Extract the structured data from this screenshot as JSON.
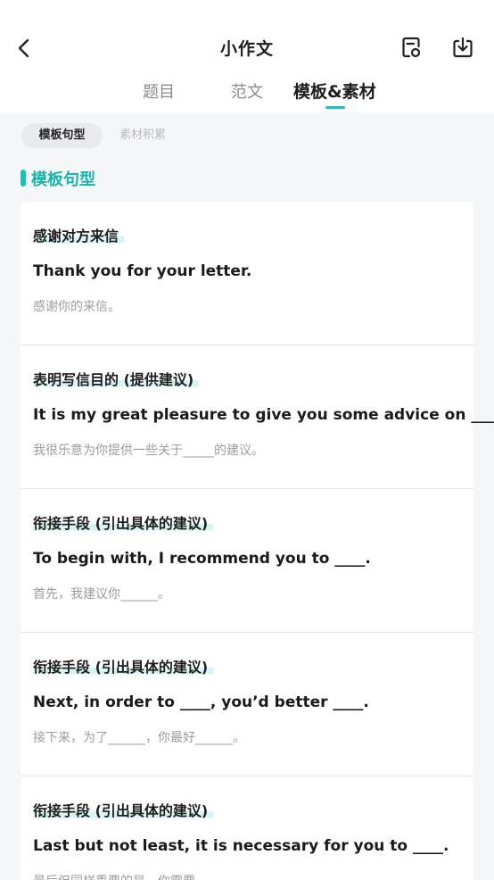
{
  "header": {
    "title": "小作文",
    "icons": [
      "back-arrow-icon",
      "document-settings-icon",
      "download-icon"
    ]
  },
  "tabs": [
    {
      "label": "题目",
      "active": false
    },
    {
      "label": "范文",
      "active": false
    },
    {
      "label": "模板&素材",
      "active": true
    }
  ],
  "chips": [
    {
      "label": "模板句型",
      "active": true
    },
    {
      "label": "素材积累",
      "active": false
    }
  ],
  "section": {
    "title": "模板句型"
  },
  "cards": [
    {
      "label": "感谢对方来信",
      "en": "Thank you for your letter.",
      "zh": "感谢你的来信。"
    },
    {
      "label": "表明写信目的 (提供建议)",
      "en": "It is my great pleasure to give you some advice on ____.",
      "zh": "我很乐意为你提供一些关于_____的建议。"
    },
    {
      "label": "衔接手段 (引出具体的建议)",
      "en": "To begin with, I recommend you to ____.",
      "zh": "首先，我建议你______。"
    },
    {
      "label": "衔接手段 (引出具体的建议)",
      "en": "Next, in order to ____, you’d better ____.",
      "zh": "接下来，为了______，你最好______。"
    },
    {
      "label": "衔接手段 (引出具体的建议)",
      "en": "Last but not least, it is necessary for you to ____.",
      "zh": "最后但同样重要的是，你需要______。"
    }
  ],
  "colors": {
    "accent": "#17c3b6",
    "background": "#f5f6f8"
  }
}
